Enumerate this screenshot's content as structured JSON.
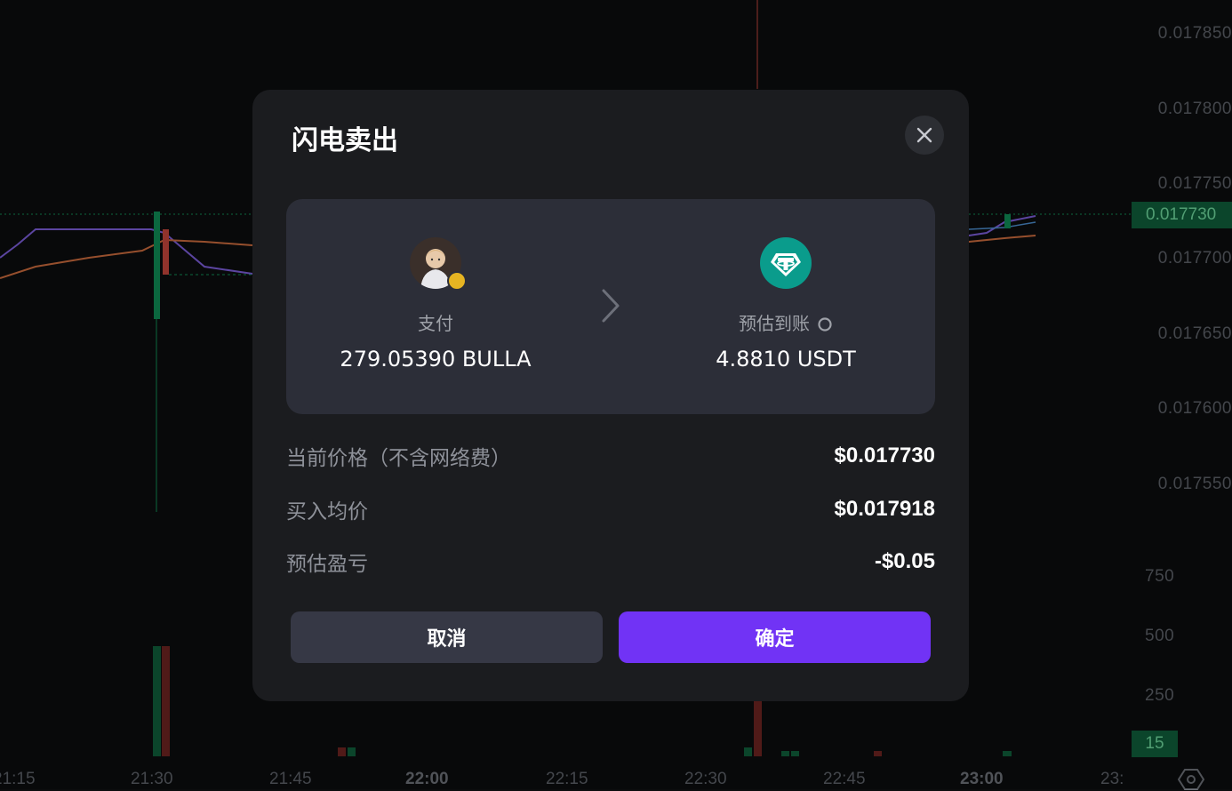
{
  "chart": {
    "price_axis": [
      "0.017850",
      "0.017800",
      "0.017750",
      "0.017700",
      "0.017650",
      "0.017600",
      "0.017550"
    ],
    "current_price_tag": "0.017730",
    "volume_axis": [
      "750",
      "500",
      "250"
    ],
    "volume_tag": "15",
    "time_axis": [
      "21:15",
      "21:30",
      "21:45",
      "22:00",
      "22:15",
      "22:30",
      "22:45",
      "23:00",
      "23:"
    ],
    "colors": {
      "up": "#0f8a55",
      "down": "#c2443b",
      "ma1": "#7a5cd6",
      "ma2": "#c96a3d"
    }
  },
  "modal": {
    "title": "闪电卖出",
    "pay": {
      "label": "支付",
      "amount": "279.05390 BULLA",
      "icon": "bulla-token-avatar"
    },
    "receive": {
      "label": "预估到账",
      "amount": "4.8810 USDT",
      "icon": "usdt-icon"
    },
    "rows": [
      {
        "label": "当前价格（不含网络费）",
        "value": "$0.017730"
      },
      {
        "label": "买入均价",
        "value": "$0.017918"
      },
      {
        "label": "预估盈亏",
        "value": "-$0.05"
      }
    ],
    "cancel_label": "取消",
    "confirm_label": "确定",
    "colors": {
      "confirm": "#7133f5",
      "usdt": "#0a9c8c"
    }
  }
}
